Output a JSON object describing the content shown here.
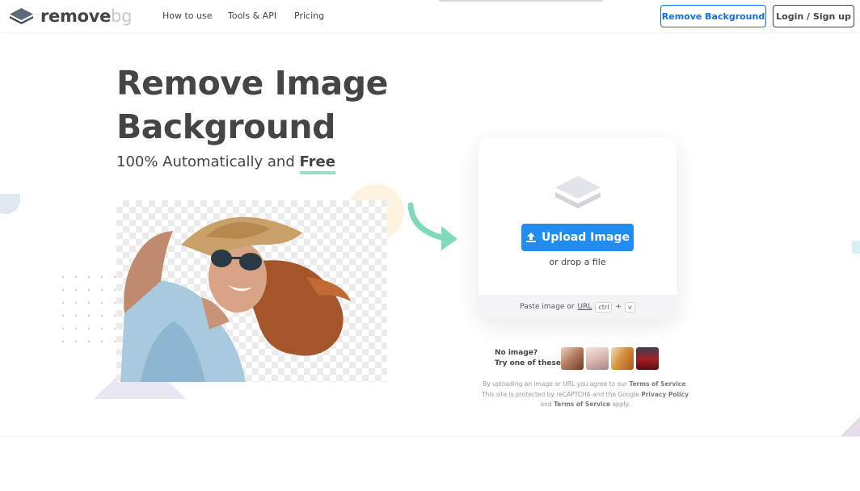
{
  "header": {
    "logo": {
      "word_main": "remove",
      "word_accent": "bg"
    },
    "nav": [
      "How to use",
      "Tools & API",
      "Pricing"
    ],
    "remove_background_label": "Remove Background",
    "login_label": "Login / Sign up"
  },
  "hero": {
    "title_line1": "Remove Image",
    "title_line2": "Background",
    "subtitle_prefix": "100% Automatically and ",
    "subtitle_emphasis": "Free"
  },
  "upload": {
    "button_label": "Upload Image",
    "drop_text": "or drop a file",
    "paste_prefix": "Paste image or ",
    "paste_url": "URL",
    "kbd_ctrl": "ctrl",
    "kbd_plus": "+",
    "kbd_v": "v"
  },
  "samples": {
    "line1": "No image?",
    "line2": "Try one of these:",
    "icons": [
      "sample-woman",
      "sample-cake",
      "sample-bread",
      "sample-car"
    ]
  },
  "legal": {
    "t1": "By uploading an image or URL you agree to our ",
    "terms": "Terms of Service",
    "t2": ".",
    "t3": "This site is protected by reCAPTCHA and the Google ",
    "privacy": "Privacy Policy",
    "t4": "and ",
    "terms2": "Terms of Service",
    "t5": " apply."
  },
  "colors": {
    "primary": "#1f8df2",
    "accent_underline": "#96e2c6",
    "text": "#454545"
  }
}
